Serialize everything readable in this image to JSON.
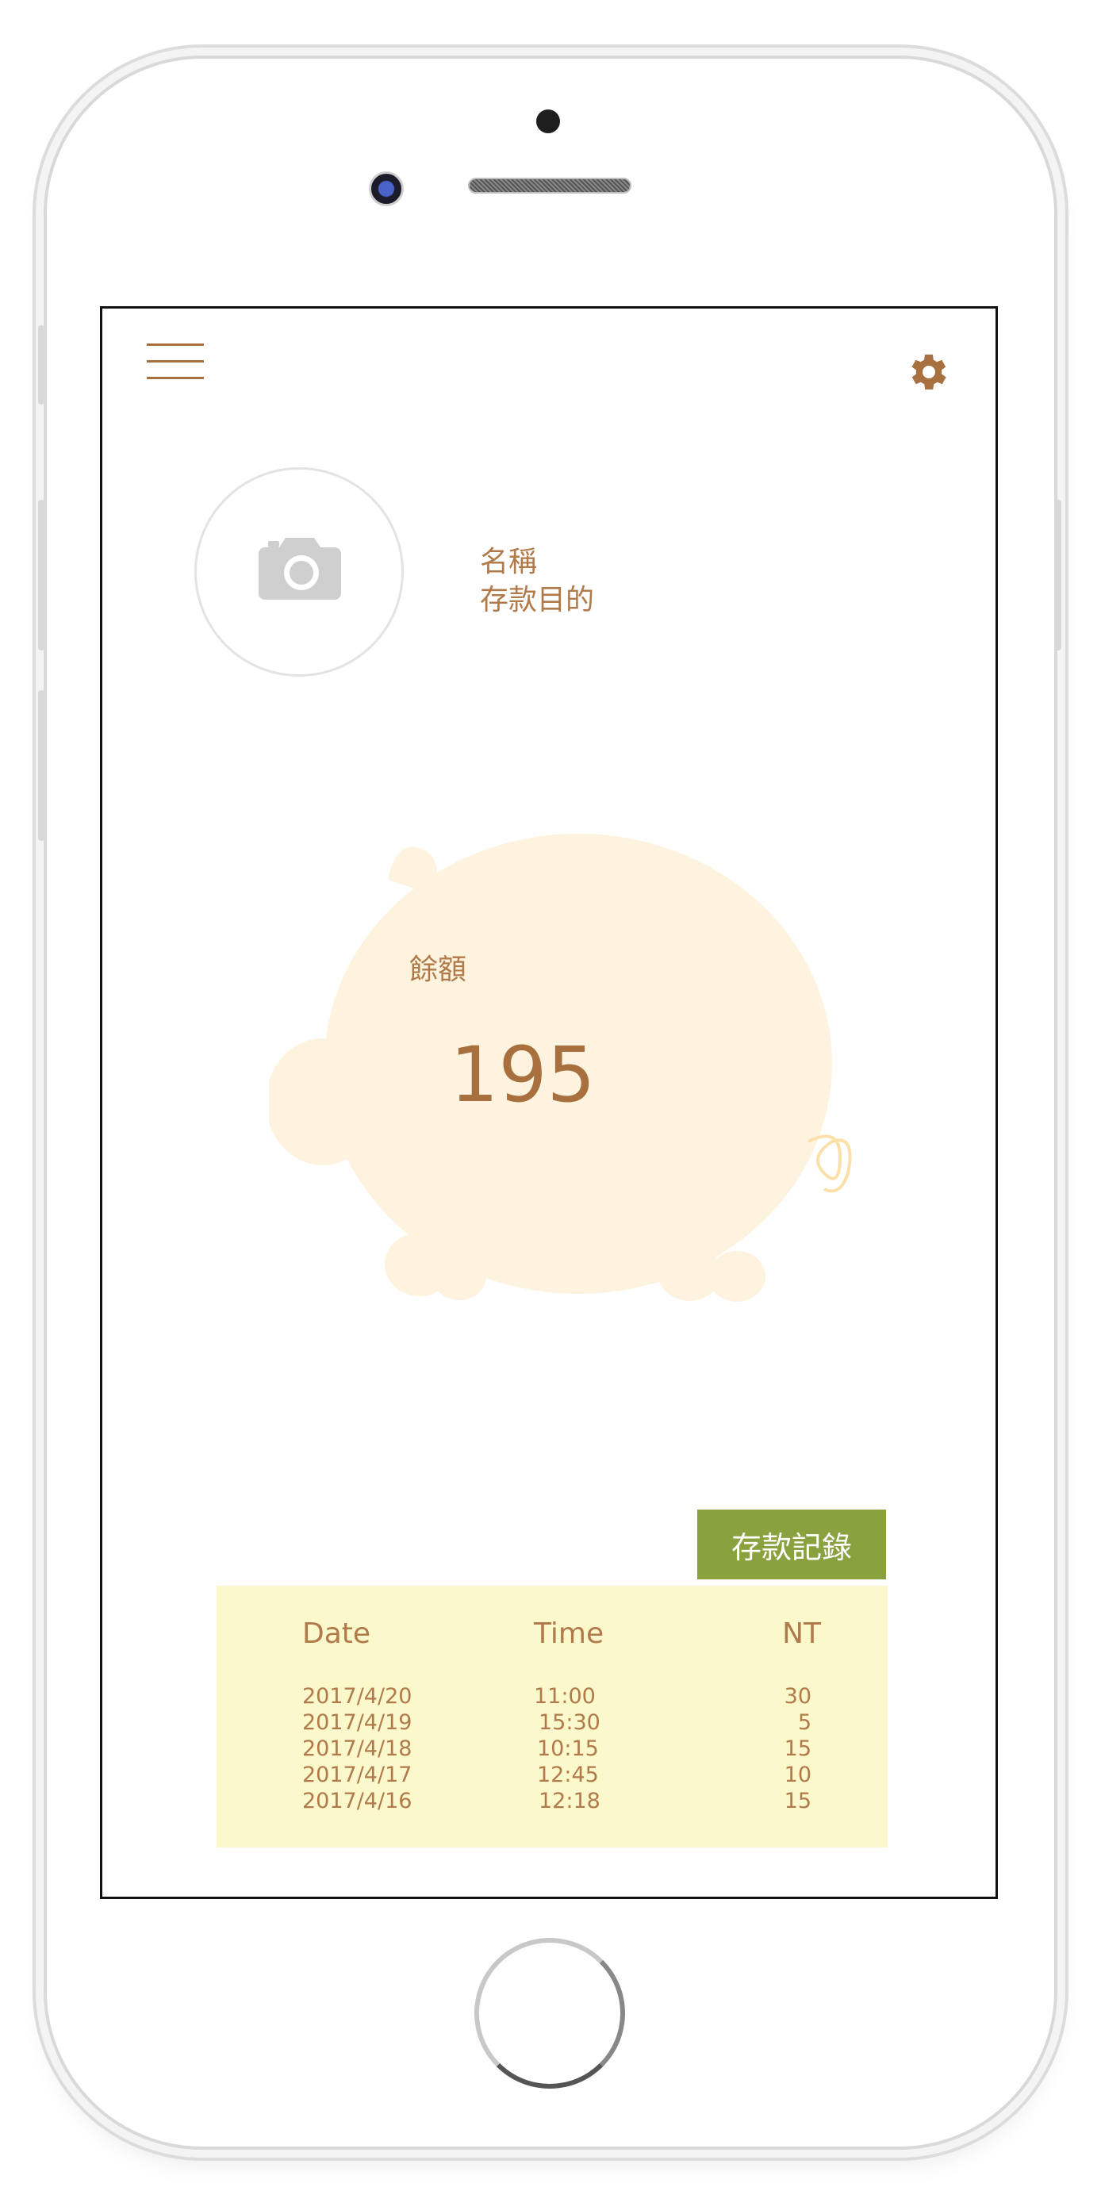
{
  "header": {
    "menu_icon": "hamburger-menu-icon",
    "settings_icon": "gear-icon"
  },
  "profile": {
    "photo_icon": "camera-icon",
    "name_label": "名稱",
    "purpose_label": "存款目的"
  },
  "balance": {
    "label": "餘額",
    "value": "195"
  },
  "records": {
    "button_label": "存款記錄",
    "columns": [
      "Date",
      "Time",
      "NT"
    ],
    "rows": [
      {
        "date": "2017/4/20",
        "time": "11:00",
        "nt": "30"
      },
      {
        "date": "2017/4/19",
        "time": "15:30",
        "nt": "5"
      },
      {
        "date": "2017/4/18",
        "time": "10:15",
        "nt": "15"
      },
      {
        "date": "2017/4/17",
        "time": "12:45",
        "nt": "10"
      },
      {
        "date": "2017/4/16",
        "time": "12:18",
        "nt": "15"
      }
    ]
  },
  "colors": {
    "accent_brown": "#a8703e",
    "button_green": "#8aa140",
    "table_bg": "#fbf8cc",
    "pig_fill": "#fef3de"
  }
}
